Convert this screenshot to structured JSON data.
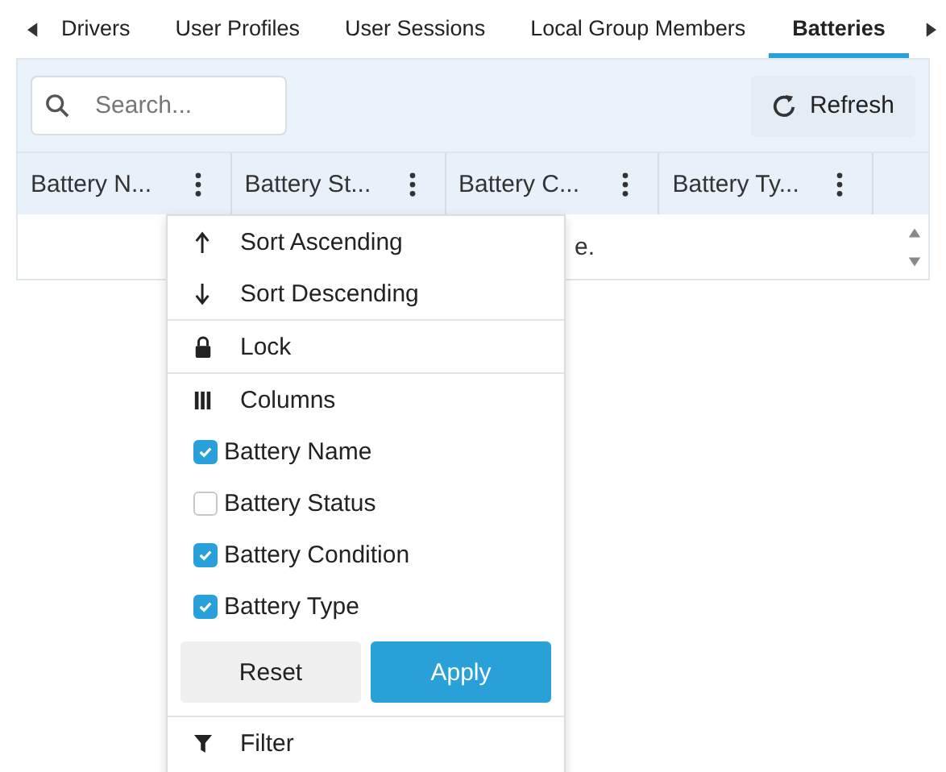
{
  "tabs": [
    {
      "label": "Drivers",
      "selected": false
    },
    {
      "label": "User Profiles",
      "selected": false
    },
    {
      "label": "User Sessions",
      "selected": false
    },
    {
      "label": "Local Group Members",
      "selected": false
    },
    {
      "label": "Batteries",
      "selected": true
    }
  ],
  "toolbar": {
    "search": {
      "placeholder": "Search..."
    },
    "refresh": "Refresh"
  },
  "table": {
    "columns": [
      "Battery N...",
      "Battery St...",
      "Battery C...",
      "Battery Ty..."
    ],
    "message": "e."
  },
  "column_menu": {
    "items": [
      {
        "kind": "sort-ascending",
        "label": "Sort Ascending"
      },
      {
        "kind": "sort-descending",
        "label": "Sort Descending"
      },
      {
        "kind": "lock",
        "label": "Lock"
      },
      {
        "kind": "columns",
        "label": "Columns"
      }
    ],
    "column_options": [
      {
        "label": "Battery Name",
        "checked": true
      },
      {
        "label": "Battery Status",
        "checked": false
      },
      {
        "label": "Battery Condition",
        "checked": true
      },
      {
        "label": "Battery Type",
        "checked": true
      }
    ],
    "reset": "Reset",
    "apply": "Apply",
    "filter": {
      "kind": "filter",
      "label": "Filter"
    }
  }
}
